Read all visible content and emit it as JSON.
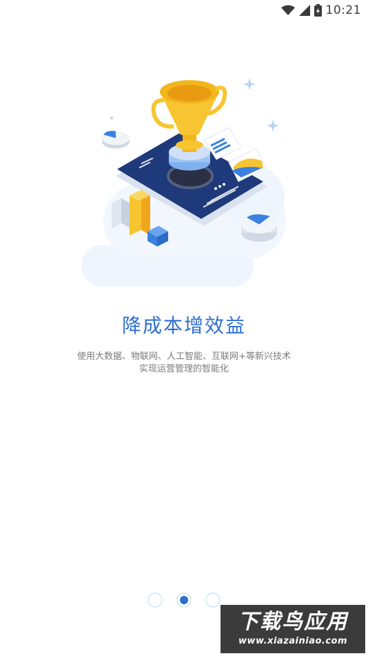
{
  "status_bar": {
    "time": "10:21",
    "icons": [
      "wifi-icon",
      "cellular-signal-icon",
      "battery-icon"
    ]
  },
  "onboarding": {
    "title": "降成本增效益",
    "description": "使用大数据、物联网、人工智能、互联网+等新兴技术实现运营管理的智能化",
    "illustration": "trophy-on-phone-illustration"
  },
  "pager": {
    "total": 3,
    "active_index": 1
  },
  "watermark": {
    "title": "下载鸟应用",
    "url": "www.xiazainiao.com"
  },
  "colors": {
    "accent": "#2f6fd0",
    "pager_inactive": "#d8ecf6",
    "text_secondary": "#7a7a7a"
  }
}
